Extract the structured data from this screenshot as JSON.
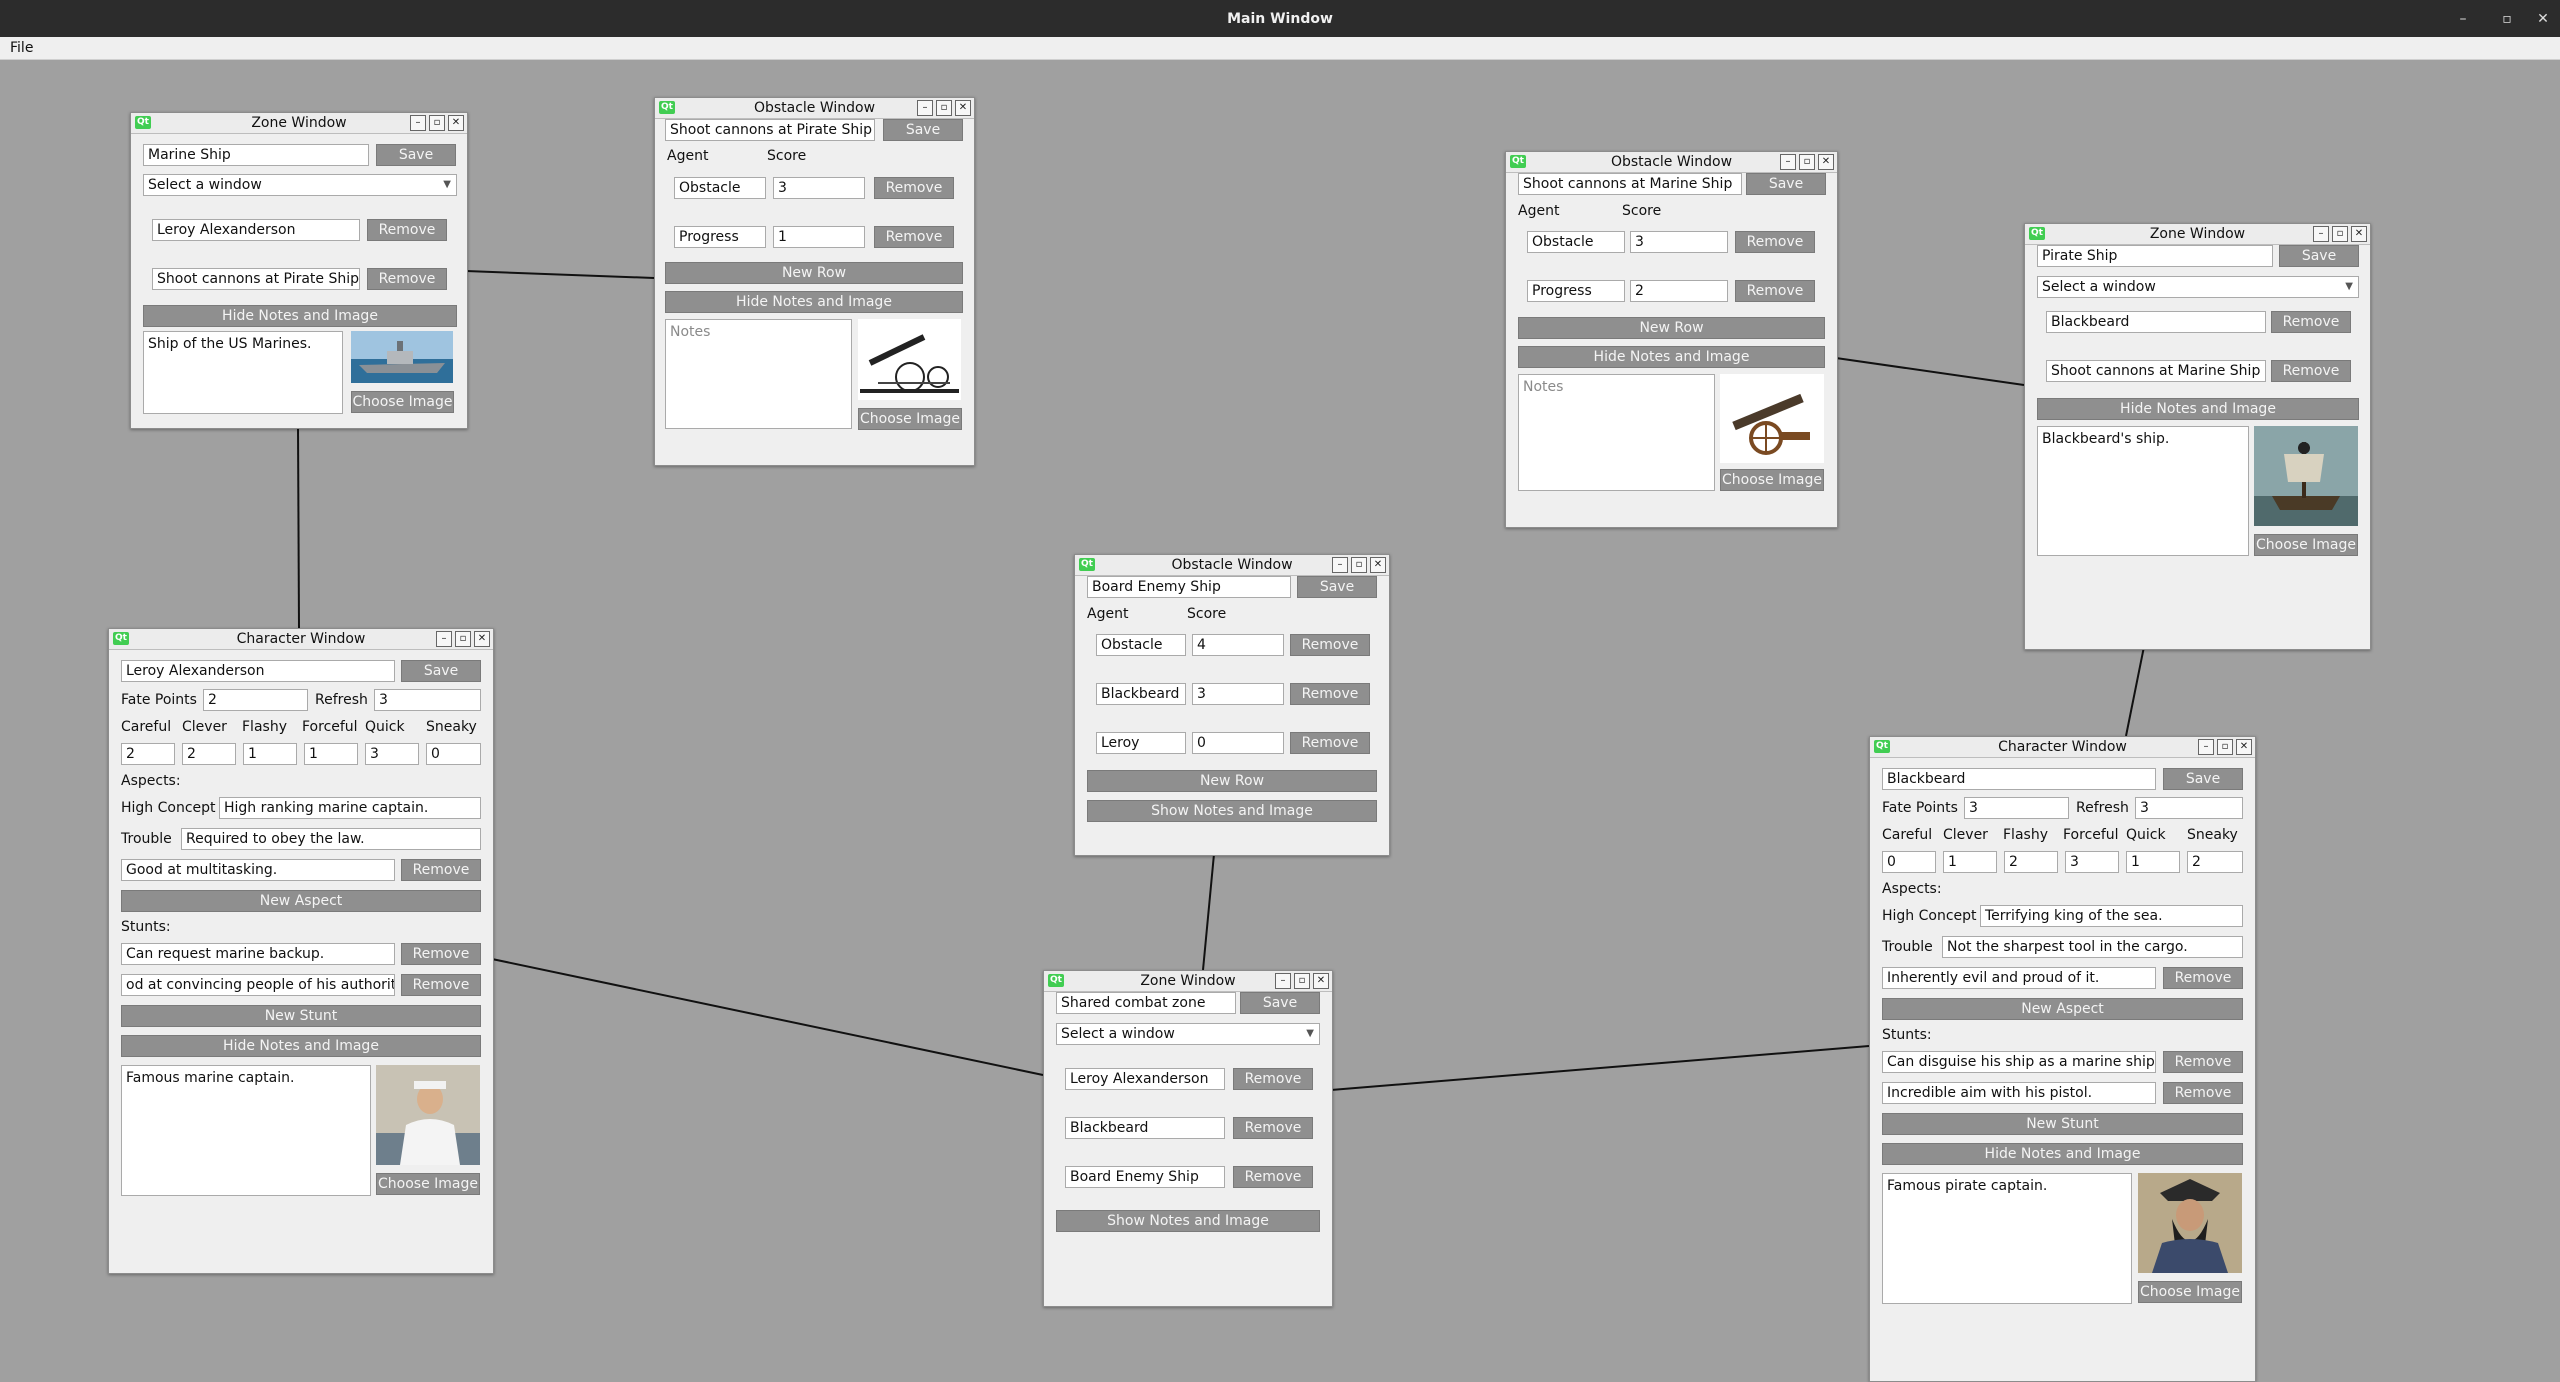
{
  "app": {
    "title": "Main Window",
    "menu": {
      "file": "File"
    },
    "window_controls": {
      "minimize": "–",
      "maximize": "▫",
      "close": "✕"
    }
  },
  "windows": {
    "zone_marine": {
      "title": "Zone Window",
      "name_value": "Marine Ship",
      "save": "Save",
      "select_value": "Select a window",
      "rows": [
        {
          "value": "Leroy Alexanderson",
          "remove": "Remove"
        },
        {
          "value": "Shoot cannons at Pirate Ship",
          "remove": "Remove"
        }
      ],
      "toggle_notes": "Hide Notes and Image",
      "notes": "Ship of the US Marines.",
      "choose_image": "Choose Image"
    },
    "obstacle_pirate": {
      "title": "Obstacle Window",
      "name_value": "Shoot cannons at Pirate Ship",
      "save": "Save",
      "agent_label": "Agent",
      "score_label": "Score",
      "rows": [
        {
          "agent": "Obstacle",
          "score": "3",
          "remove": "Remove"
        },
        {
          "agent": "Progress",
          "score": "1",
          "remove": "Remove"
        }
      ],
      "new_row": "New Row",
      "toggle_notes": "Hide Notes and Image",
      "notes_placeholder": "Notes",
      "choose_image": "Choose Image"
    },
    "obstacle_marine": {
      "title": "Obstacle Window",
      "name_value": "Shoot cannons at Marine Ship",
      "save": "Save",
      "agent_label": "Agent",
      "score_label": "Score",
      "rows": [
        {
          "agent": "Obstacle",
          "score": "3",
          "remove": "Remove"
        },
        {
          "agent": "Progress",
          "score": "2",
          "remove": "Remove"
        }
      ],
      "new_row": "New Row",
      "toggle_notes": "Hide Notes and Image",
      "notes_placeholder": "Notes",
      "choose_image": "Choose Image"
    },
    "zone_pirate": {
      "title": "Zone Window",
      "name_value": "Pirate Ship",
      "save": "Save",
      "select_value": "Select a window",
      "rows": [
        {
          "value": "Blackbeard",
          "remove": "Remove"
        },
        {
          "value": "Shoot cannons at Marine Ship",
          "remove": "Remove"
        }
      ],
      "toggle_notes": "Hide Notes and Image",
      "notes": "Blackbeard's ship.",
      "choose_image": "Choose Image"
    },
    "obstacle_board": {
      "title": "Obstacle Window",
      "name_value": "Board Enemy Ship",
      "save": "Save",
      "agent_label": "Agent",
      "score_label": "Score",
      "rows": [
        {
          "agent": "Obstacle",
          "score": "4",
          "remove": "Remove"
        },
        {
          "agent": "Blackbeard",
          "score": "3",
          "remove": "Remove"
        },
        {
          "agent": "Leroy",
          "score": "0",
          "remove": "Remove"
        }
      ],
      "new_row": "New Row",
      "toggle_notes": "Show Notes and Image"
    },
    "character_leroy": {
      "title": "Character Window",
      "name_value": "Leroy Alexanderson",
      "save": "Save",
      "fate_points_label": "Fate Points",
      "fate_points": "2",
      "refresh_label": "Refresh",
      "refresh": "3",
      "approach_labels": [
        "Careful",
        "Clever",
        "Flashy",
        "Forceful",
        "Quick",
        "Sneaky"
      ],
      "approach_values": [
        "2",
        "2",
        "1",
        "1",
        "3",
        "0"
      ],
      "aspects_label": "Aspects:",
      "high_concept_label": "High Concept",
      "high_concept": "High ranking marine captain.",
      "trouble_label": "Trouble",
      "trouble": "Required to obey the law.",
      "aspect_rows": [
        {
          "value": "Good at multitasking.",
          "remove": "Remove"
        }
      ],
      "new_aspect": "New Aspect",
      "stunts_label": "Stunts:",
      "stunt_rows": [
        {
          "value": "Can request marine backup.",
          "remove": "Remove"
        },
        {
          "value": "od at convincing people of his authority.",
          "remove": "Remove"
        }
      ],
      "new_stunt": "New Stunt",
      "toggle_notes": "Hide Notes and Image",
      "notes": "Famous marine captain.",
      "choose_image": "Choose Image"
    },
    "zone_shared": {
      "title": "Zone Window",
      "name_value": "Shared combat zone",
      "save": "Save",
      "select_value": "Select a window",
      "rows": [
        {
          "value": "Leroy Alexanderson",
          "remove": "Remove"
        },
        {
          "value": "Blackbeard",
          "remove": "Remove"
        },
        {
          "value": "Board Enemy Ship",
          "remove": "Remove"
        }
      ],
      "toggle_notes": "Show Notes and Image"
    },
    "character_blackbeard": {
      "title": "Character Window",
      "name_value": "Blackbeard",
      "save": "Save",
      "fate_points_label": "Fate Points",
      "fate_points": "3",
      "refresh_label": "Refresh",
      "refresh": "3",
      "approach_labels": [
        "Careful",
        "Clever",
        "Flashy",
        "Forceful",
        "Quick",
        "Sneaky"
      ],
      "approach_values": [
        "0",
        "1",
        "2",
        "3",
        "1",
        "2"
      ],
      "aspects_label": "Aspects:",
      "high_concept_label": "High Concept",
      "high_concept": "Terrifying king of the sea.",
      "trouble_label": "Trouble",
      "trouble": "Not the sharpest tool in the cargo.",
      "aspect_rows": [
        {
          "value": "Inherently evil and proud of it.",
          "remove": "Remove"
        }
      ],
      "new_aspect": "New Aspect",
      "stunts_label": "Stunts:",
      "stunt_rows": [
        {
          "value": "Can disguise his ship as a marine ship.",
          "remove": "Remove"
        },
        {
          "value": "Incredible aim with his pistol.",
          "remove": "Remove"
        }
      ],
      "new_stunt": "New Stunt",
      "toggle_notes": "Hide Notes and Image",
      "notes": "Famous pirate captain.",
      "choose_image": "Choose Image"
    }
  }
}
